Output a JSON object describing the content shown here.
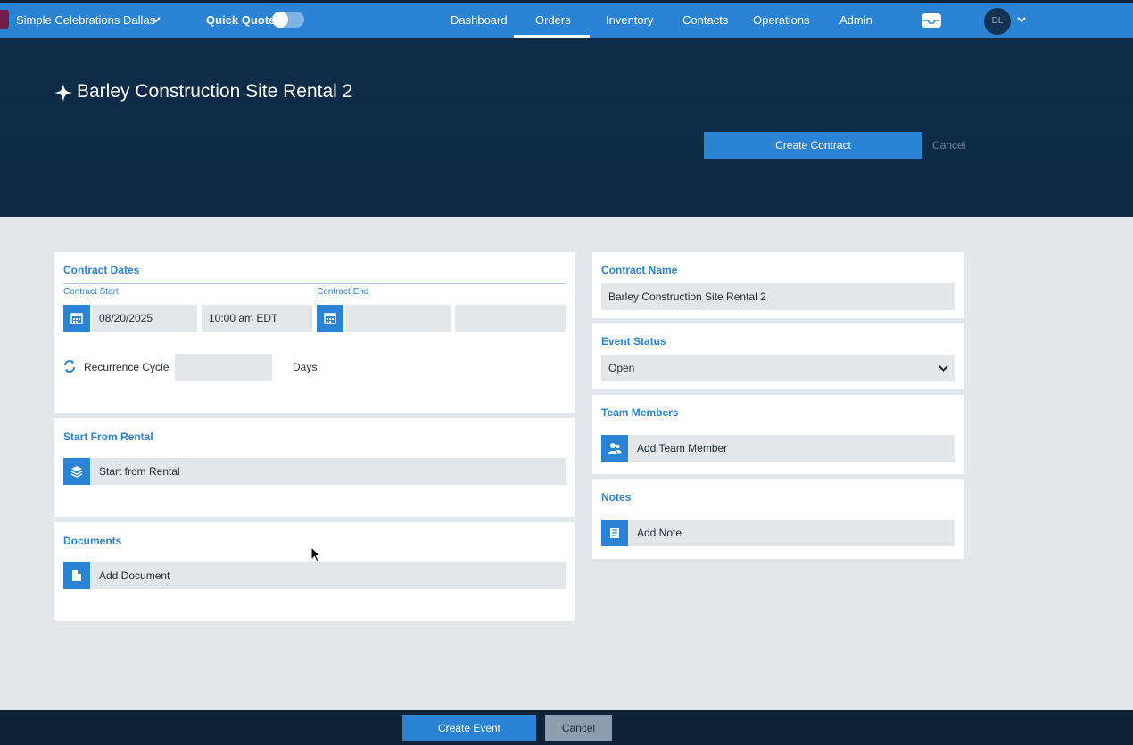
{
  "topbar": {
    "brand": "Simple Celebrations Dallas",
    "quick_quote": "Quick Quote",
    "nav": [
      "Dashboard",
      "Orders",
      "Inventory",
      "Contacts",
      "Operations",
      "Admin"
    ],
    "active_nav": "Orders",
    "avatar_initials": "DL"
  },
  "header": {
    "title": "Barley Construction Site Rental 2",
    "create_contract": "Create Contract",
    "cancel": "Cancel"
  },
  "contract_dates": {
    "title": "Contract Dates",
    "start_label": "Contract Start",
    "end_label": "Contract End",
    "start_date": "08/20/2025",
    "start_time": "10:00 am EDT",
    "end_date": "",
    "end_time": "",
    "recurrence_label": "Recurrence Cycle",
    "recurrence_value": "",
    "recurrence_unit": "Days"
  },
  "start_from_rental": {
    "title": "Start From Rental",
    "button": "Start from Rental"
  },
  "documents": {
    "title": "Documents",
    "button": "Add Document"
  },
  "contract_name": {
    "title": "Contract Name",
    "value": "Barley Construction Site Rental 2"
  },
  "event_status": {
    "title": "Event Status",
    "value": "Open"
  },
  "team_members": {
    "title": "Team Members",
    "button": "Add Team Member"
  },
  "notes": {
    "title": "Notes",
    "button": "Add Note"
  },
  "footer": {
    "create_event": "Create Event",
    "cancel": "Cancel"
  },
  "colors": {
    "primary": "#2b83d6",
    "nav_bg": "#2b83d6",
    "hero_bg": "#0d2c4a",
    "field_bg": "#e4e7e9",
    "footer_bg": "#0e2238"
  }
}
